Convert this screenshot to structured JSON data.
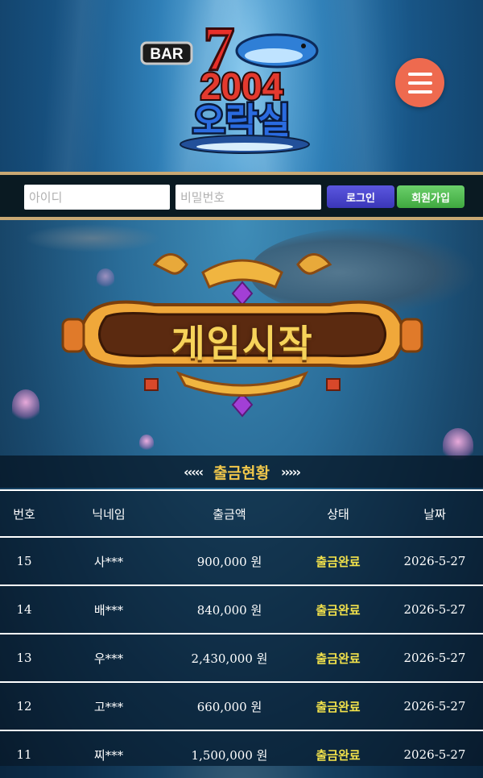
{
  "header": {
    "logo_text": {
      "bar": "BAR",
      "seven": "7",
      "year": "2004",
      "name": "오락실"
    }
  },
  "login": {
    "id_placeholder": "아이디",
    "pw_placeholder": "비밀번호",
    "login_label": "로그인",
    "join_label": "회원가입"
  },
  "main": {
    "start_label": "게임시작"
  },
  "withdrawals": {
    "title": "출금현황",
    "arrows_left": "‹‹‹‹‹",
    "arrows_right": "›››››",
    "headers": {
      "no": "번호",
      "nick": "닉네임",
      "amount": "출금액",
      "status": "상태",
      "date": "날짜"
    },
    "rows": [
      {
        "no": "15",
        "nick": "사***",
        "amount": "900,000 원",
        "status": "출금완료",
        "date": "2026-5-27"
      },
      {
        "no": "14",
        "nick": "배***",
        "amount": "840,000 원",
        "status": "출금완료",
        "date": "2026-5-27"
      },
      {
        "no": "13",
        "nick": "우***",
        "amount": "2,430,000 원",
        "status": "출금완료",
        "date": "2026-5-27"
      },
      {
        "no": "12",
        "nick": "고***",
        "amount": "660,000 원",
        "status": "출금완료",
        "date": "2026-5-27"
      },
      {
        "no": "11",
        "nick": "찌***",
        "amount": "1,500,000 원",
        "status": "출금완료",
        "date": "2026-5-27"
      }
    ]
  },
  "colors": {
    "menu": "#ee6a4f",
    "login_btn": "#4a46cc",
    "join_btn": "#52bc52",
    "gold": "#f2c84b"
  },
  "icons": {
    "menu": "hamburger-menu-icon"
  }
}
